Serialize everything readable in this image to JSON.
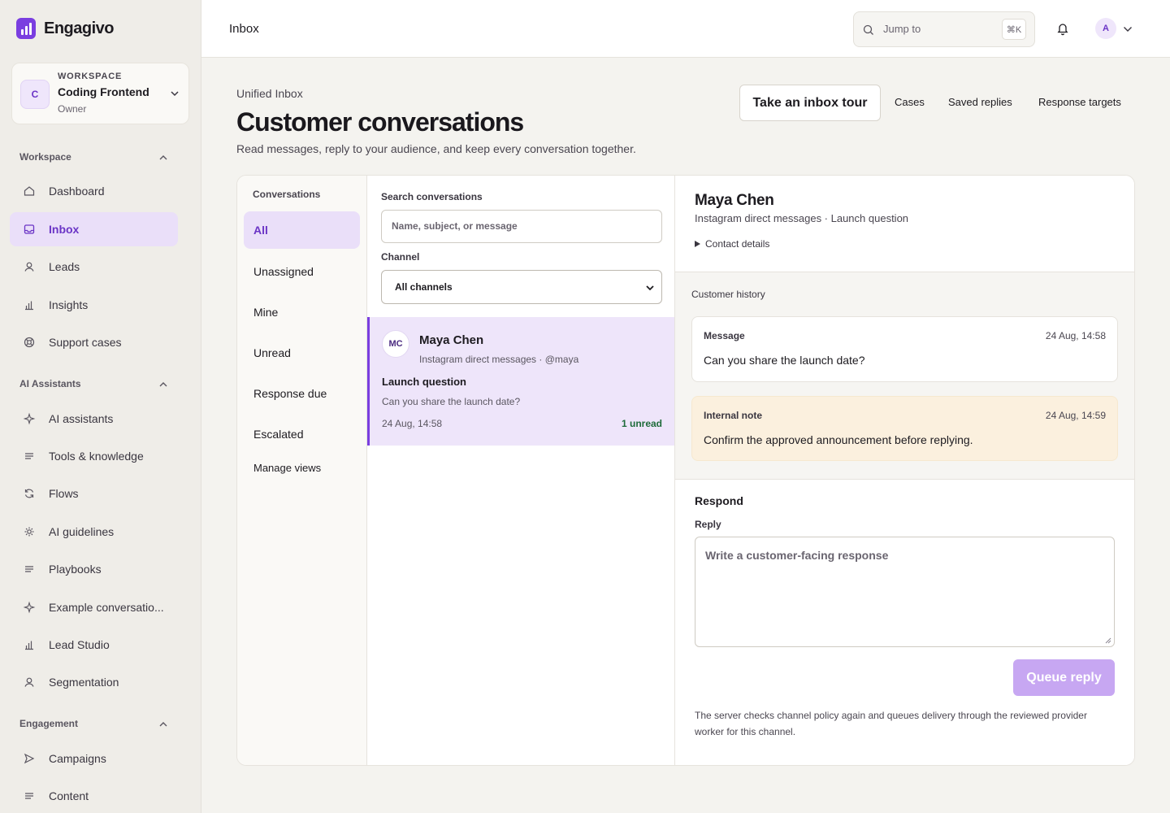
{
  "app": {
    "name": "Engagivo",
    "brand_color": "#7a3ee0"
  },
  "workspace": {
    "eyebrow": "WORKSPACE",
    "name": "Coding Frontend",
    "role": "Owner",
    "initial": "C"
  },
  "sidebar": {
    "sections": [
      {
        "title": "Workspace"
      },
      {
        "title": "AI Assistants"
      },
      {
        "title": "Engagement"
      }
    ],
    "items": [
      {
        "label": "Dashboard",
        "icon": "home-icon"
      },
      {
        "label": "Inbox",
        "icon": "inbox-icon",
        "active": true
      },
      {
        "label": "Leads",
        "icon": "user-icon"
      },
      {
        "label": "Insights",
        "icon": "bar-chart-icon"
      },
      {
        "label": "Support cases",
        "icon": "lifebuoy-icon"
      },
      {
        "label": "AI assistants",
        "icon": "sparkle-icon"
      },
      {
        "label": "Tools & knowledge",
        "icon": "lines-icon"
      },
      {
        "label": "Flows",
        "icon": "refresh-icon"
      },
      {
        "label": "AI guidelines",
        "icon": "gear-icon"
      },
      {
        "label": "Playbooks",
        "icon": "lines-icon"
      },
      {
        "label": "Example conversatio...",
        "icon": "sparkle-icon"
      },
      {
        "label": "Lead Studio",
        "icon": "bar-chart-icon"
      },
      {
        "label": "Segmentation",
        "icon": "user-icon"
      },
      {
        "label": "Campaigns",
        "icon": "send-icon"
      },
      {
        "label": "Content",
        "icon": "lines-icon"
      }
    ]
  },
  "topbar": {
    "title": "Inbox",
    "jump_placeholder": "Jump to",
    "jump_shortcut": "⌘K",
    "avatar_initial": "A"
  },
  "page": {
    "eyebrow": "Unified Inbox",
    "title": "Customer conversations",
    "subtitle": "Read messages, reply to your audience, and keep every conversation together.",
    "tour_button": "Take an inbox tour",
    "links": [
      "Cases",
      "Saved replies",
      "Response targets"
    ]
  },
  "views": {
    "label": "Conversations",
    "items": [
      "All",
      "Unassigned",
      "Mine",
      "Unread",
      "Response due",
      "Escalated",
      "Manage views"
    ]
  },
  "list": {
    "search_label": "Search conversations",
    "search_placeholder": "Name, subject, or message",
    "channel_label": "Channel",
    "channel_value": "All channels",
    "conversations": [
      {
        "initials": "MC",
        "name": "Maya Chen",
        "channel": "Instagram direct messages · @maya",
        "subject": "Launch question",
        "preview": "Can you share the launch date?",
        "time": "24 Aug, 14:58",
        "unread": "1 unread"
      }
    ]
  },
  "detail": {
    "name": "Maya Chen",
    "meta": "Instagram direct messages · Launch question",
    "contact_toggle": "Contact details",
    "history_label": "Customer history",
    "history": [
      {
        "type": "Message",
        "time": "24 Aug, 14:58",
        "body": "Can you share the launch date?"
      },
      {
        "type": "Internal note",
        "time": "24 Aug, 14:59",
        "body": "Confirm the approved announcement before replying."
      }
    ],
    "respond_title": "Respond",
    "reply_label": "Reply",
    "reply_placeholder": "Write a customer-facing response",
    "queue_button": "Queue reply",
    "policy_note": "The server checks channel policy again and queues delivery through the reviewed provider worker for this channel."
  }
}
